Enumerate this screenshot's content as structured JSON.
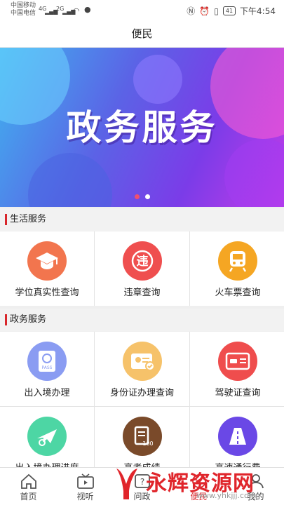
{
  "status_bar": {
    "carrier1": "中国移动",
    "carrier2": "中国电信",
    "net1": "4G",
    "net2": "2G",
    "battery": "41",
    "time": "下午4:54"
  },
  "nav": {
    "title": "便民"
  },
  "banner": {
    "title": "政务服务",
    "slides": 2,
    "active_slide": 1
  },
  "sections": [
    {
      "title": "生活服务",
      "items": [
        {
          "label": "学位真实性查询",
          "icon": "graduation-cap-icon",
          "color": "#f2754e"
        },
        {
          "label": "违章查询",
          "icon": "traffic-violation-icon",
          "color": "#ef4f4f"
        },
        {
          "label": "火车票查询",
          "icon": "train-icon",
          "color": "#f5a623"
        }
      ]
    },
    {
      "title": "政务服务",
      "items": [
        {
          "label": "出入境办理",
          "icon": "passport-icon",
          "color": "#8a9cf2"
        },
        {
          "label": "身份证办理查询",
          "icon": "id-card-icon",
          "color": "#f6c26a"
        },
        {
          "label": "驾驶证查询",
          "icon": "driver-license-icon",
          "color": "#ef4d4d"
        },
        {
          "label": "出入境办理进度",
          "icon": "airplane-icon",
          "color": "#4dd6a4"
        },
        {
          "label": "高考成绩",
          "icon": "exam-score-icon",
          "color": "#7a4a2a"
        },
        {
          "label": "高速通行费",
          "icon": "highway-icon",
          "color": "#6a48e6"
        }
      ]
    }
  ],
  "tabs": [
    {
      "label": "首页",
      "icon": "home-icon"
    },
    {
      "label": "视听",
      "icon": "tv-icon"
    },
    {
      "label": "问政",
      "icon": "question-icon"
    },
    {
      "label": "便民",
      "icon": "convenience-icon",
      "active": true
    },
    {
      "label": "我的",
      "icon": "user-icon"
    }
  ],
  "watermark": {
    "text": "永辉资源网",
    "url": "www.yhkjjj.com"
  },
  "colors": {
    "accent": "#d8262b",
    "page_bg": "#efefef"
  }
}
